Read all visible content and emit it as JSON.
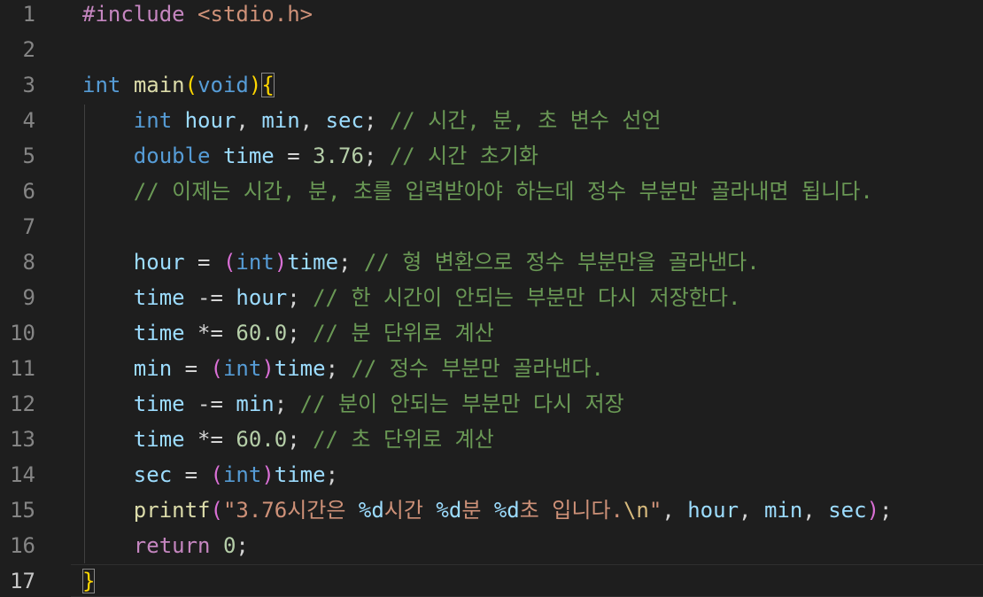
{
  "editor": {
    "line_numbers": [
      "1",
      "2",
      "3",
      "4",
      "5",
      "6",
      "7",
      "8",
      "9",
      "10",
      "11",
      "12",
      "13",
      "14",
      "15",
      "16",
      "17"
    ],
    "lines": [
      [
        {
          "t": "#include",
          "c": "ctrl"
        },
        {
          "t": " ",
          "c": ""
        },
        {
          "t": "<stdio.h>",
          "c": "str"
        }
      ],
      [],
      [
        {
          "t": "int",
          "c": "kw"
        },
        {
          "t": " ",
          "c": ""
        },
        {
          "t": "main",
          "c": "fn"
        },
        {
          "t": "(",
          "c": "p1"
        },
        {
          "t": "void",
          "c": "kw"
        },
        {
          "t": ")",
          "c": "p1"
        },
        {
          "t": "{",
          "c": "p1",
          "box": true
        }
      ],
      [
        {
          "t": "    ",
          "c": ""
        },
        {
          "t": "int",
          "c": "kw"
        },
        {
          "t": " ",
          "c": ""
        },
        {
          "t": "hour",
          "c": "var"
        },
        {
          "t": ", ",
          "c": ""
        },
        {
          "t": "min",
          "c": "var"
        },
        {
          "t": ", ",
          "c": ""
        },
        {
          "t": "sec",
          "c": "var"
        },
        {
          "t": "; ",
          "c": ""
        },
        {
          "t": "// 시간, 분, 초 변수 선언",
          "c": "cmt"
        }
      ],
      [
        {
          "t": "    ",
          "c": ""
        },
        {
          "t": "double",
          "c": "kw"
        },
        {
          "t": " ",
          "c": ""
        },
        {
          "t": "time",
          "c": "var"
        },
        {
          "t": " = ",
          "c": ""
        },
        {
          "t": "3.76",
          "c": "num"
        },
        {
          "t": "; ",
          "c": ""
        },
        {
          "t": "// 시간 초기화",
          "c": "cmt"
        }
      ],
      [
        {
          "t": "    ",
          "c": ""
        },
        {
          "t": "// 이제는 시간, 분, 초를 입력받아야 하는데 정수 부분만 골라내면 됩니다.",
          "c": "cmt"
        }
      ],
      [],
      [
        {
          "t": "    ",
          "c": ""
        },
        {
          "t": "hour",
          "c": "var"
        },
        {
          "t": " = ",
          "c": ""
        },
        {
          "t": "(",
          "c": "p2"
        },
        {
          "t": "int",
          "c": "kw"
        },
        {
          "t": ")",
          "c": "p2"
        },
        {
          "t": "time",
          "c": "var"
        },
        {
          "t": "; ",
          "c": ""
        },
        {
          "t": "// 형 변환으로 정수 부분만을 골라낸다.",
          "c": "cmt"
        }
      ],
      [
        {
          "t": "    ",
          "c": ""
        },
        {
          "t": "time",
          "c": "var"
        },
        {
          "t": " -= ",
          "c": ""
        },
        {
          "t": "hour",
          "c": "var"
        },
        {
          "t": "; ",
          "c": ""
        },
        {
          "t": "// 한 시간이 안되는 부분만 다시 저장한다.",
          "c": "cmt"
        }
      ],
      [
        {
          "t": "    ",
          "c": ""
        },
        {
          "t": "time",
          "c": "var"
        },
        {
          "t": " *= ",
          "c": ""
        },
        {
          "t": "60.0",
          "c": "num"
        },
        {
          "t": "; ",
          "c": ""
        },
        {
          "t": "// 분 단위로 계산",
          "c": "cmt"
        }
      ],
      [
        {
          "t": "    ",
          "c": ""
        },
        {
          "t": "min",
          "c": "var"
        },
        {
          "t": " = ",
          "c": ""
        },
        {
          "t": "(",
          "c": "p2"
        },
        {
          "t": "int",
          "c": "kw"
        },
        {
          "t": ")",
          "c": "p2"
        },
        {
          "t": "time",
          "c": "var"
        },
        {
          "t": "; ",
          "c": ""
        },
        {
          "t": "// 정수 부분만 골라낸다.",
          "c": "cmt"
        }
      ],
      [
        {
          "t": "    ",
          "c": ""
        },
        {
          "t": "time",
          "c": "var"
        },
        {
          "t": " -= ",
          "c": ""
        },
        {
          "t": "min",
          "c": "var"
        },
        {
          "t": "; ",
          "c": ""
        },
        {
          "t": "// 분이 안되는 부분만 다시 저장",
          "c": "cmt"
        }
      ],
      [
        {
          "t": "    ",
          "c": ""
        },
        {
          "t": "time",
          "c": "var"
        },
        {
          "t": " *= ",
          "c": ""
        },
        {
          "t": "60.0",
          "c": "num"
        },
        {
          "t": "; ",
          "c": ""
        },
        {
          "t": "// 초 단위로 계산",
          "c": "cmt"
        }
      ],
      [
        {
          "t": "    ",
          "c": ""
        },
        {
          "t": "sec",
          "c": "var"
        },
        {
          "t": " = ",
          "c": ""
        },
        {
          "t": "(",
          "c": "p2"
        },
        {
          "t": "int",
          "c": "kw"
        },
        {
          "t": ")",
          "c": "p2"
        },
        {
          "t": "time",
          "c": "var"
        },
        {
          "t": ";",
          "c": ""
        }
      ],
      [
        {
          "t": "    ",
          "c": ""
        },
        {
          "t": "printf",
          "c": "fn"
        },
        {
          "t": "(",
          "c": "p2"
        },
        {
          "t": "\"3.76시간은 ",
          "c": "str"
        },
        {
          "t": "%d",
          "c": "fmt"
        },
        {
          "t": "시간 ",
          "c": "str"
        },
        {
          "t": "%d",
          "c": "fmt"
        },
        {
          "t": "분 ",
          "c": "str"
        },
        {
          "t": "%d",
          "c": "fmt"
        },
        {
          "t": "초 입니다.",
          "c": "str"
        },
        {
          "t": "\\n",
          "c": "esc"
        },
        {
          "t": "\"",
          "c": "str"
        },
        {
          "t": ", ",
          "c": ""
        },
        {
          "t": "hour",
          "c": "var"
        },
        {
          "t": ", ",
          "c": ""
        },
        {
          "t": "min",
          "c": "var"
        },
        {
          "t": ", ",
          "c": ""
        },
        {
          "t": "sec",
          "c": "var"
        },
        {
          "t": ")",
          "c": "p2"
        },
        {
          "t": ";",
          "c": ""
        }
      ],
      [
        {
          "t": "    ",
          "c": ""
        },
        {
          "t": "return",
          "c": "ctrl"
        },
        {
          "t": " ",
          "c": ""
        },
        {
          "t": "0",
          "c": "num"
        },
        {
          "t": ";",
          "c": ""
        }
      ],
      [
        {
          "t": "}",
          "c": "p1",
          "box": true
        }
      ]
    ],
    "active_line": 17,
    "colors": {
      "background": "#1e1e1e",
      "keyword": "#569cd6",
      "control": "#c586c0",
      "function": "#dcdcaa",
      "variable": "#9cdcfe",
      "number": "#b5cea8",
      "string": "#ce9178",
      "comment": "#6a9955",
      "bracket_level1": "#ffd700",
      "bracket_level2": "#da70d6"
    }
  }
}
